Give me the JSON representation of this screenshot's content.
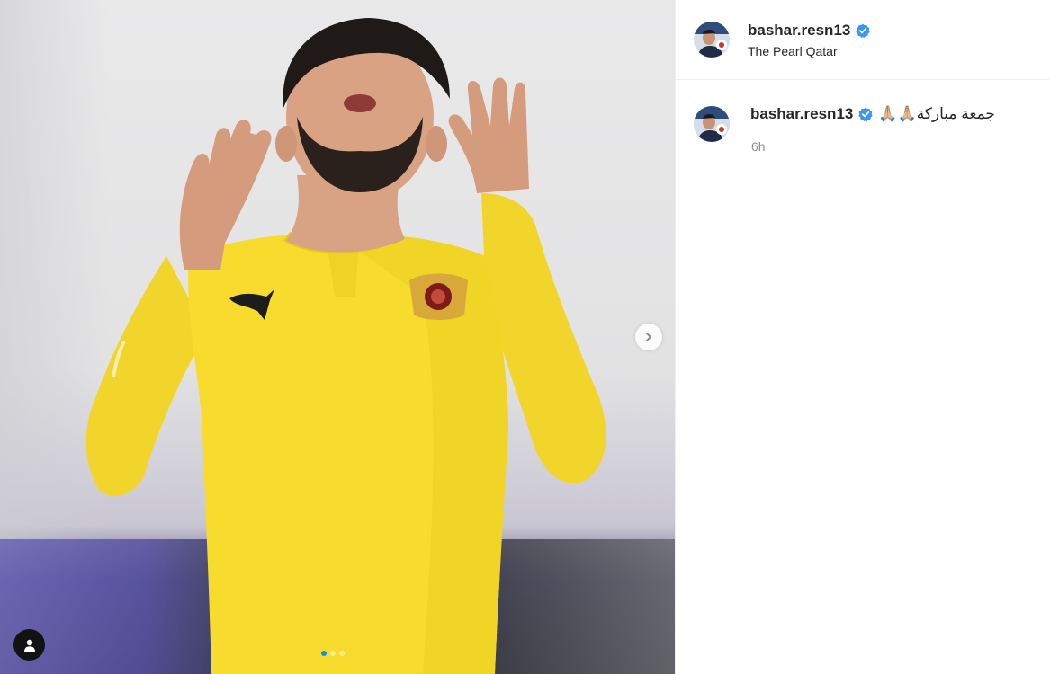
{
  "post": {
    "media": {
      "photo_description_icon": "photo-icon",
      "carousel": {
        "slide_count": 3,
        "active_index": 0
      },
      "next_icon": "chevron-right-icon",
      "tag_icon": "user-icon"
    },
    "header": {
      "username": "bashar.resn13",
      "verified": true,
      "location": "The Pearl Qatar"
    },
    "caption": {
      "username": "bashar.resn13",
      "text": "جمعة مباركة🙏🏼🙏🏼",
      "time": "6h"
    }
  },
  "colors": {
    "verified_badge": "#3897f0",
    "active_dot": "#0095f6",
    "jersey_yellow": "#f7dc2d"
  }
}
